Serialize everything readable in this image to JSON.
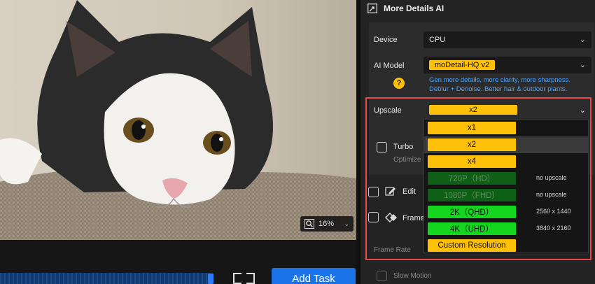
{
  "preview": {
    "zoom_level": "16%"
  },
  "bottom_bar": {
    "add_task_label": "Add Task"
  },
  "panel": {
    "title": "More Details AI",
    "device": {
      "label": "Device",
      "value": "CPU"
    },
    "ai_model": {
      "label": "AI Model",
      "value": "moDetail-HQ  v2",
      "hint_line1": "Gen more details, more clarity, more sharpness.",
      "hint_line2": "Deblur + Denoise. Better hair & outdoor plants.",
      "help_glyph": "?"
    },
    "upscale": {
      "label": "Upscale",
      "value": "x2"
    },
    "turbo": {
      "label": "Turbo",
      "sublabel": "Optimize"
    },
    "edit": {
      "label": "Edit"
    },
    "frame": {
      "label": "Frame"
    },
    "frame_rate_label": "Frame Rate",
    "slow_motion_label": "Slow Motion"
  },
  "dropdown": {
    "options": [
      {
        "label": "x1",
        "style": "yellow",
        "side": ""
      },
      {
        "label": "x2",
        "style": "yellow",
        "side": ""
      },
      {
        "label": "x4",
        "style": "yellow",
        "side": ""
      },
      {
        "label": "720P（HD）",
        "style": "dgreen",
        "side": "no upscale"
      },
      {
        "label": "1080P（FHD）",
        "style": "dgreen",
        "side": "no upscale"
      },
      {
        "label": "2K（QHD）",
        "style": "green",
        "side": "2560 x 1440"
      },
      {
        "label": "4K（UHD）",
        "style": "green",
        "side": "3840 x 2160"
      },
      {
        "label": "Custom Resolution",
        "style": "yellow",
        "side": ""
      }
    ],
    "hovered_index": 1
  },
  "colors": {
    "accent_blue": "#1a73e8",
    "highlight_red": "#e84a4a",
    "option_yellow": "#ffc107",
    "option_green": "#14d61f",
    "option_dark_green": "#0f5f16"
  }
}
